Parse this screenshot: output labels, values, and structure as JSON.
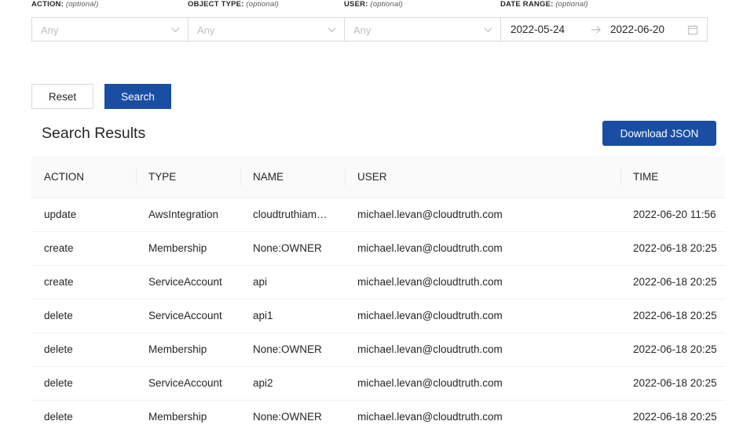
{
  "filters": {
    "action": {
      "label": "ACTION:",
      "optional": "(optional)",
      "placeholder": "Any"
    },
    "object_type": {
      "label": "OBJECT TYPE:",
      "optional": "(optional)",
      "placeholder": "Any"
    },
    "user": {
      "label": "USER:",
      "optional": "(optional)",
      "placeholder": "Any"
    },
    "date_range": {
      "label": "DATE RANGE:",
      "optional": "(optional)",
      "start": "2022-05-24",
      "end": "2022-06-20"
    }
  },
  "buttons": {
    "reset": "Reset",
    "search": "Search",
    "download": "Download JSON"
  },
  "results_title": "Search Results",
  "table": {
    "columns": [
      "ACTION",
      "TYPE",
      "NAME",
      "USER",
      "TIME"
    ],
    "rows": [
      [
        "update",
        "AwsIntegration",
        "cloudtruthiam…",
        "michael.levan@cloudtruth.com",
        "2022-06-20 11:56"
      ],
      [
        "create",
        "Membership",
        "None:OWNER",
        "michael.levan@cloudtruth.com",
        "2022-06-18 20:25"
      ],
      [
        "create",
        "ServiceAccount",
        "api",
        "michael.levan@cloudtruth.com",
        "2022-06-18 20:25"
      ],
      [
        "delete",
        "ServiceAccount",
        "api1",
        "michael.levan@cloudtruth.com",
        "2022-06-18 20:25"
      ],
      [
        "delete",
        "Membership",
        "None:OWNER",
        "michael.levan@cloudtruth.com",
        "2022-06-18 20:25"
      ],
      [
        "delete",
        "ServiceAccount",
        "api2",
        "michael.levan@cloudtruth.com",
        "2022-06-18 20:25"
      ],
      [
        "delete",
        "Membership",
        "None:OWNER",
        "michael.levan@cloudtruth.com",
        "2022-06-18 20:25"
      ]
    ]
  },
  "colors": {
    "primary": "#1a4ea3",
    "border": "#d9d9d9",
    "header_bg": "#fafafa",
    "placeholder": "#bfbfbf"
  },
  "icons": {
    "select": "chevron-down-icon",
    "range_separator": "arrow-right-icon",
    "calendar": "calendar-icon"
  }
}
